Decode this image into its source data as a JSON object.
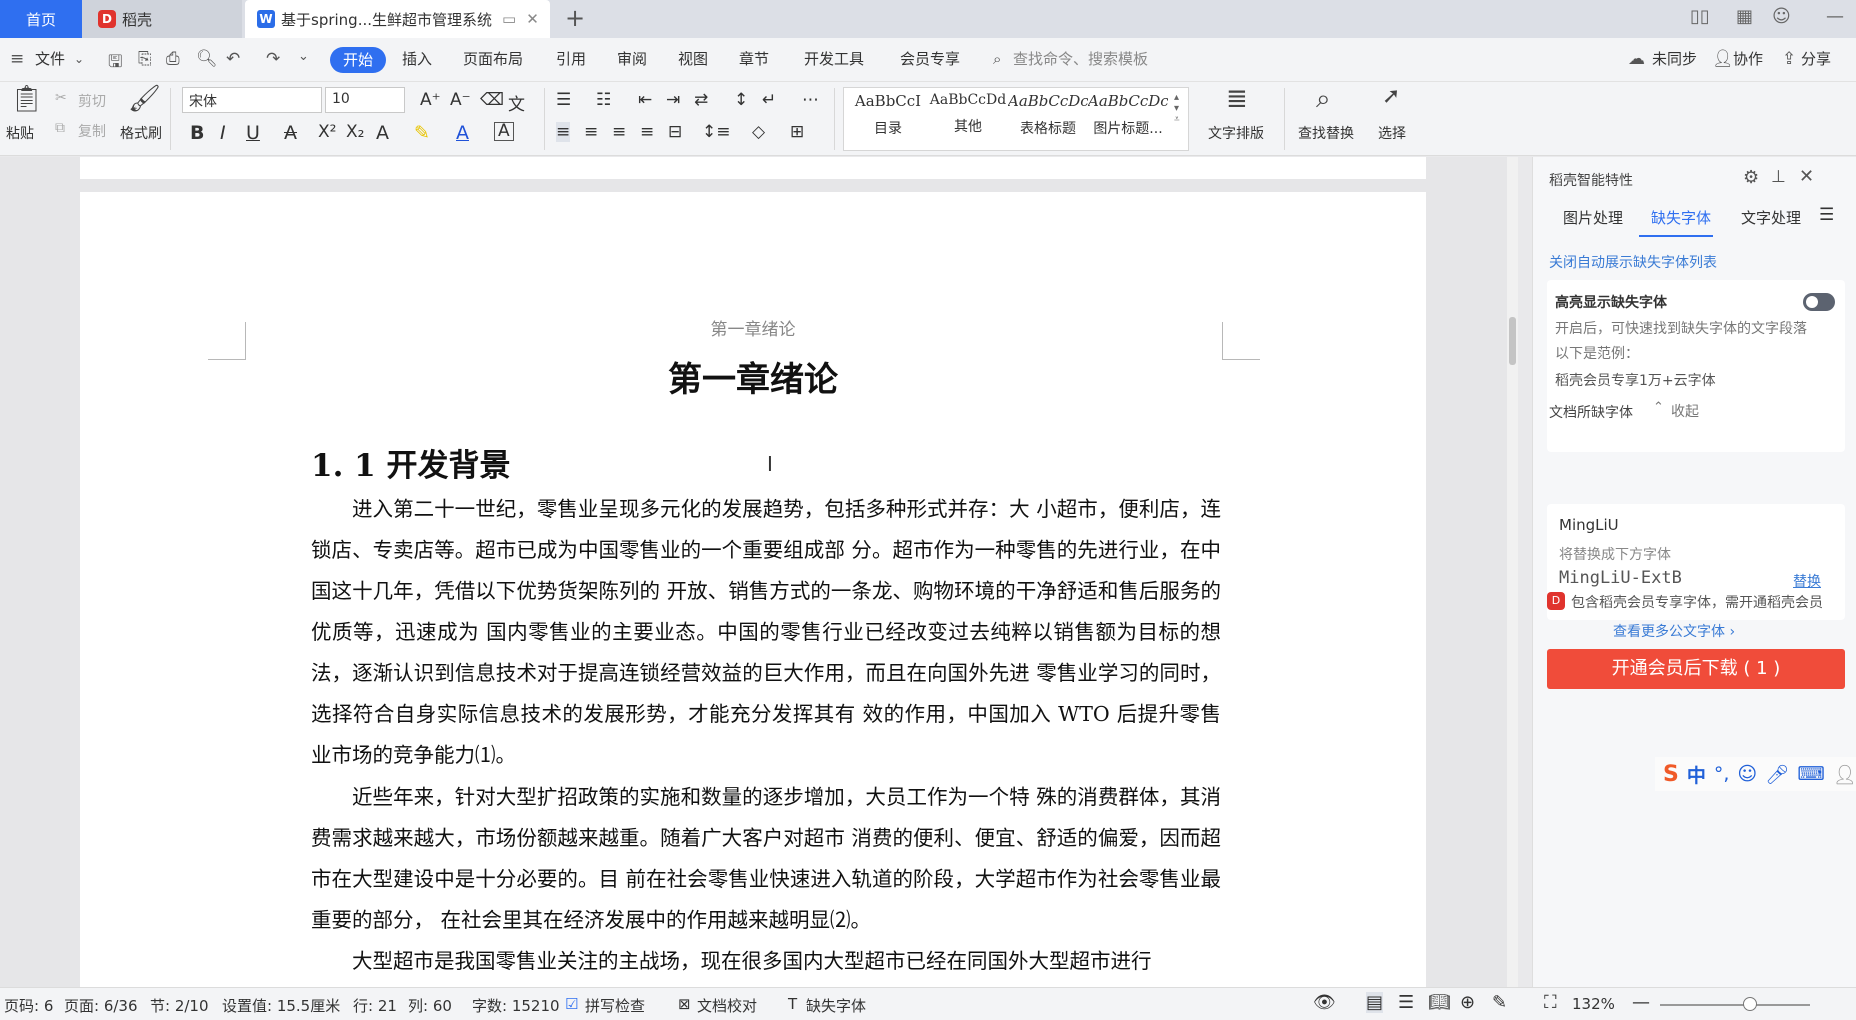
{
  "titlebar": {
    "tabs": [
      {
        "label": "首页"
      },
      {
        "label": "稻壳"
      },
      {
        "label": "基于spring...生鲜超市管理系统"
      }
    ],
    "new_tab": "+"
  },
  "menubar": {
    "file": "文件",
    "items": [
      "开始",
      "插入",
      "页面布局",
      "引用",
      "审阅",
      "视图",
      "章节",
      "开发工具",
      "会员专享"
    ],
    "search_placeholder": "查找命令、搜索模板",
    "sync": "未同步",
    "collab": "协作",
    "share": "分享"
  },
  "ribbon": {
    "paste": "粘贴",
    "cut": "剪切",
    "copy": "复制",
    "format_painter": "格式刷",
    "font_name": "宋体",
    "font_size": "10",
    "styles": [
      {
        "sample": "AaBbCcI",
        "label": "目录"
      },
      {
        "sample": "AaBbCcDd",
        "label": "其他"
      },
      {
        "sample": "AaBbCcDc",
        "label": "表格标题"
      },
      {
        "sample": "AaBbCcDc",
        "label": "图片标题..."
      }
    ],
    "text_layout": "文字排版",
    "find_replace": "查找替换",
    "select": "选择"
  },
  "document": {
    "header": "第一章绪论",
    "chapter_title": "第一章绪论",
    "section_title": "1. 1 开发背景",
    "paragraphs": [
      "进入第二十一世纪，零售业呈现多元化的发展趋势，包括多种形式并存：大 小超市，便利店，连锁店、专卖店等。超市已成为中国零售业的一个重要组成部 分。超市作为一种零售的先进行业，在中国这十几年，凭借以下优势货架陈列的 开放、销售方式的一条龙、购物环境的干净舒适和售后服务的优质等，迅速成为 国内零售业的主要业态。中国的零售行业已经改变过去纯粹以销售额为目标的想 法，逐渐认识到信息技术对于提高连锁经营效益的巨大作用，而且在向国外先进 零售业学习的同时，选择符合自身实际信息技术的发展形势，才能充分发挥其有 效的作用，中国加入 WTO 后提升零售业市场的竞争能力⑴。",
      "近些年来，针对大型扩招政策的实施和数量的逐步增加，大员工作为一个特 殊的消费群体，其消费需求越来越大，市场份额越来越重。随着广大客户对超市 消费的便利、便宜、舒适的偏爱，因而超市在大型建设中是十分必要的。目 前在社会零售业快速进入轨道的阶段，大学超市作为社会零售业最重要的部分，  在社会里其在经济发展中的作用越来越明显⑵。",
      "大型超市是我国零售业关注的主战场，现在很多国内大型超市已经在同国外大型超市进行"
    ]
  },
  "panel": {
    "title": "稻壳智能特性",
    "tabs": [
      "图片处理",
      "缺失字体",
      "文字处理"
    ],
    "active_tab": "缺失字体",
    "close_auto_link": "关闭自动展示缺失字体列表",
    "highlight_label": "高亮显示缺失字体",
    "highlight_desc": "开启后，可快速找到缺失字体的文字段落",
    "example_label": "以下是范例：",
    "example_text": "稻壳会员专享1万+云字体",
    "collapse": "收起",
    "missing_heading": "文档所缺字体",
    "missing_font": "MingLiU",
    "replace_hint": "将替换成下方字体",
    "replacement_font": "MingLiU-ExtB",
    "replace_link": "替换",
    "download_button": "开通会员后下载 ( 1 )",
    "member_note": "包含稻壳会员专享字体，需开通稻壳会员",
    "more_fonts": "查看更多公文字体 ›",
    "ime": {
      "logo": "S",
      "lang": "中",
      "punct": "°,"
    }
  },
  "statusbar": {
    "page": "页码: 6",
    "pages": "页面: 6/36",
    "section": "节: 2/10",
    "position": "设置值: 15.5厘米",
    "row": "行: 21",
    "col": "列: 60",
    "words": "字数: 15210",
    "spell": "拼写检查",
    "proof": "文档校对",
    "missing_font": "缺失字体",
    "zoom": "132%"
  },
  "colors": {
    "accent": "#2f6ff0",
    "download": "#f04c3a",
    "link": "#3a7bd5"
  }
}
